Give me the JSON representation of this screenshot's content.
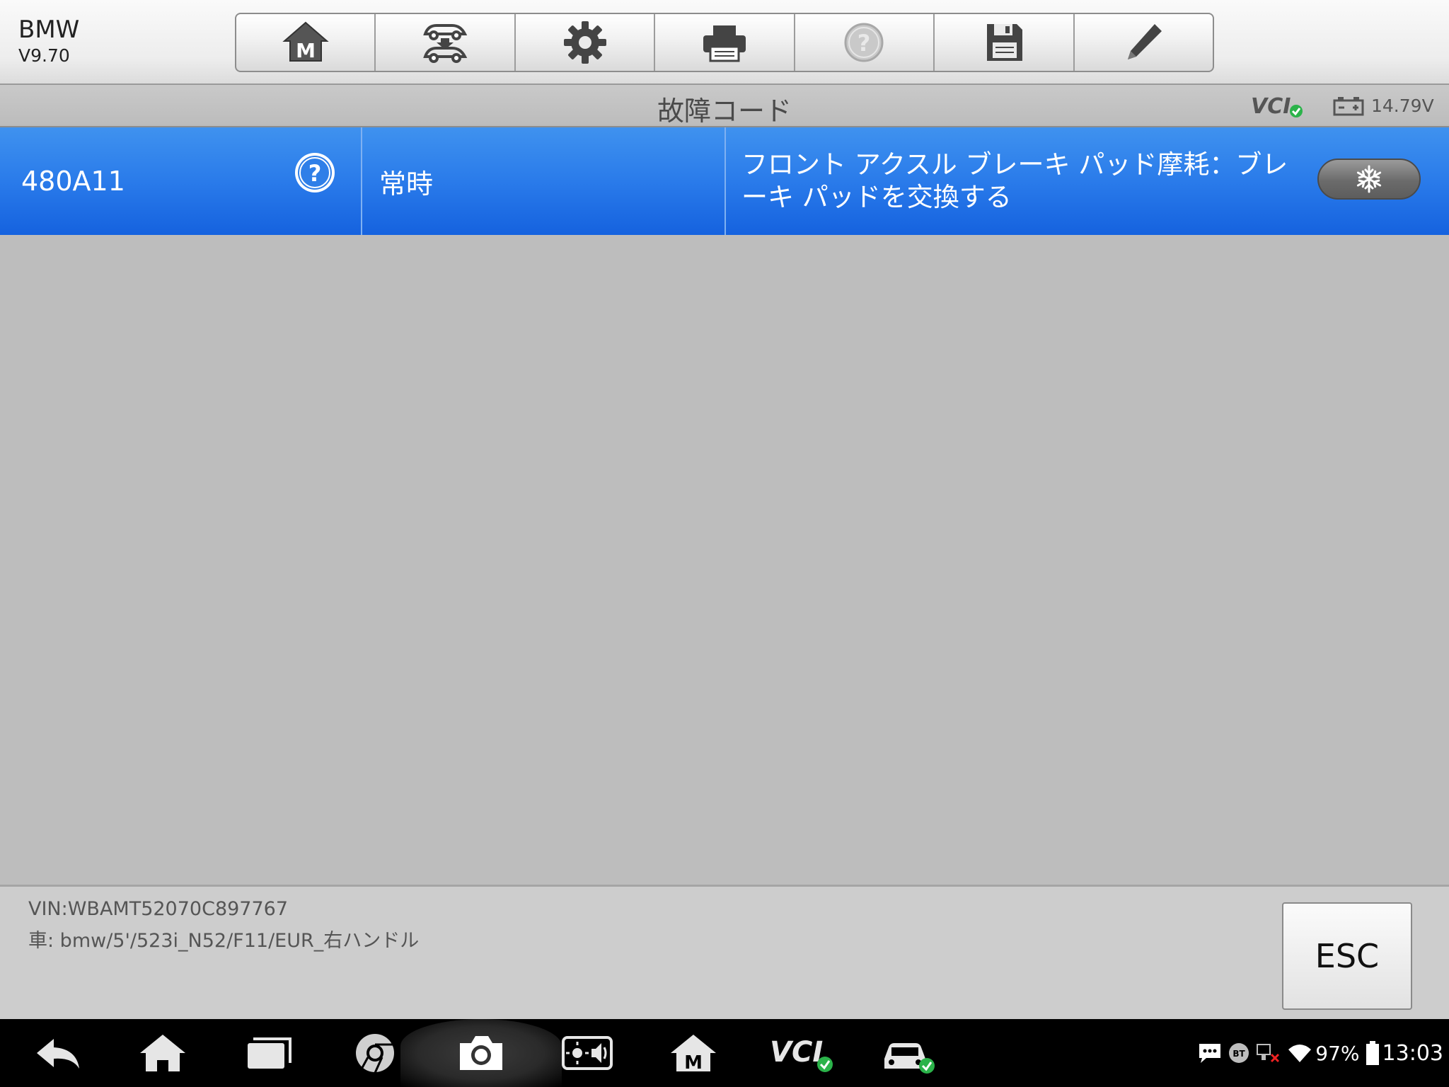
{
  "app": {
    "brand": "BMW",
    "version": "V9.70"
  },
  "toolbar": {
    "buttons": [
      "home-m-icon",
      "vehicle-swap-icon",
      "gear-icon",
      "printer-icon",
      "help-icon",
      "save-icon",
      "pencil-icon"
    ]
  },
  "titlebar": {
    "title": "故障コード",
    "vci_label": "VCI",
    "voltage": "14.79V"
  },
  "dtc_rows": [
    {
      "code": "480A11",
      "status": "常時",
      "description": "フロント アクスル ブレーキ パッド摩耗：ブレーキ パッドを交換する"
    }
  ],
  "footer": {
    "vin": "VIN:WBAMT52070C897767",
    "car": "車: bmw/5'/523i_N52/F11/EUR_右ハンドル",
    "esc_label": "ESC"
  },
  "navbar": {
    "icons": [
      "back-icon",
      "home-icon",
      "recent-apps-icon",
      "chrome-icon",
      "camera-icon",
      "brightness-volume-icon",
      "maxisys-home-icon",
      "vci-icon",
      "vehicle-icon"
    ],
    "vci_label": "VCI",
    "bt_label": "BT",
    "battery": "97%",
    "time": "13:03"
  },
  "colors": {
    "row_blue": "#2a7bea",
    "vci_green": "#2bb34a"
  }
}
